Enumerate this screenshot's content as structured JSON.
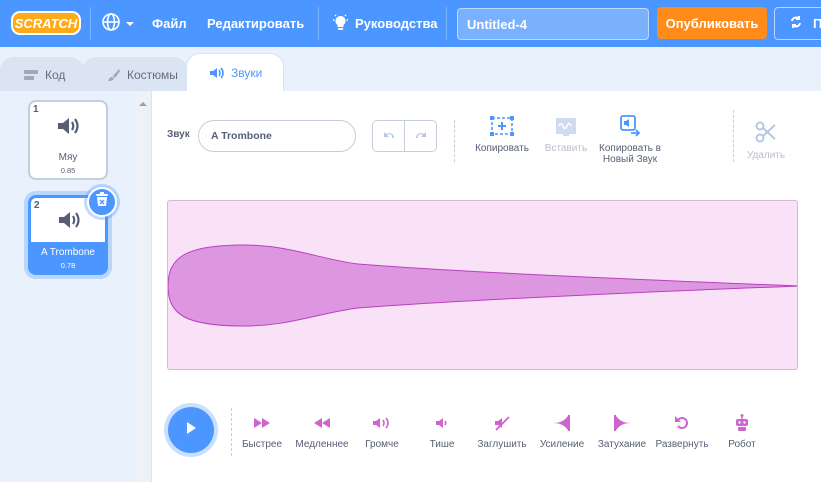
{
  "menubar": {
    "logo_text": "SCRATCH",
    "globe_icon": "globe-icon",
    "file": "Файл",
    "edit": "Редактировать",
    "tutorials": "Руководства",
    "project_title": "Untitled-4",
    "publish": "Опубликовать",
    "share_label": "П"
  },
  "tabs": [
    {
      "label": "Код",
      "icon": "code-icon"
    },
    {
      "label": "Костюмы",
      "icon": "brush-icon"
    },
    {
      "label": "Звуки",
      "icon": "speaker-icon",
      "active": true
    }
  ],
  "sounds": [
    {
      "number": "1",
      "name": "Мяу",
      "duration": "0.85"
    },
    {
      "number": "2",
      "name": "A Trombone",
      "duration": "0.78",
      "selected": true
    }
  ],
  "editor": {
    "sound_label": "Звук",
    "sound_name": "A Trombone",
    "tools": {
      "copy": "Копировать",
      "paste": "Вставить",
      "copy_new": "Копировать в Новый Звук",
      "delete": "Удалить"
    },
    "effects": [
      {
        "label": "Быстрее",
        "icon": "faster-icon"
      },
      {
        "label": "Медленнее",
        "icon": "slower-icon"
      },
      {
        "label": "Громче",
        "icon": "louder-icon"
      },
      {
        "label": "Тише",
        "icon": "softer-icon"
      },
      {
        "label": "Заглушить",
        "icon": "mute-icon"
      },
      {
        "label": "Усиление",
        "icon": "fade-in-icon"
      },
      {
        "label": "Затухание",
        "icon": "fade-out-icon"
      },
      {
        "label": "Развернуть",
        "icon": "reverse-icon"
      },
      {
        "label": "Робот",
        "icon": "robot-icon"
      }
    ]
  },
  "colors": {
    "menubar": "#4c97ff",
    "publish": "#ff8c1a",
    "waveform": "#cf63cf",
    "wave_bg": "#f9e2f8"
  }
}
